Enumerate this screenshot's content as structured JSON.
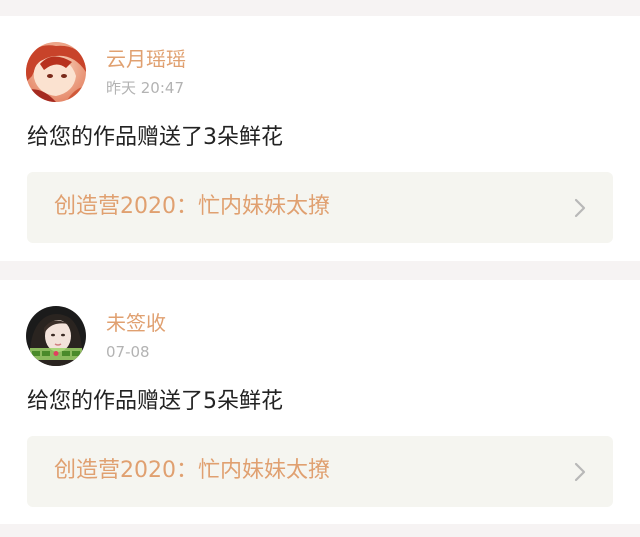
{
  "feed": {
    "items": [
      {
        "user": "云月瑶瑶",
        "time": "昨天 20:47",
        "message": "给您的作品赠送了3朵鲜花",
        "work_title": "创造营2020：忙内妹妹太撩",
        "avatar_icon": "avatar-anime-character"
      },
      {
        "user": "未签收",
        "time": "07-08",
        "message": "给您的作品赠送了5朵鲜花",
        "work_title": "创造营2020：忙内妹妹太撩",
        "avatar_icon": "avatar-girl-photo"
      }
    ]
  },
  "colors": {
    "accent": "#e0a070",
    "text": "#222222",
    "muted": "#b3b3b3",
    "card_bg": "#ffffff",
    "page_bg": "#f6f3f3",
    "link_bg": "#f5f5f0"
  }
}
